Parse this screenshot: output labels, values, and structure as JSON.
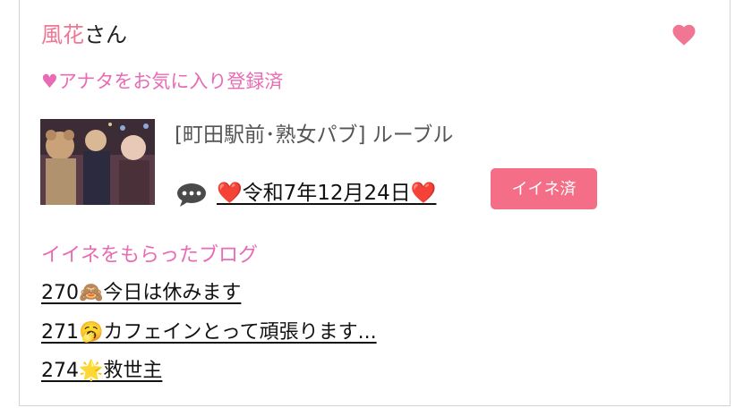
{
  "profile": {
    "name": "風花",
    "suffix": "さん"
  },
  "favorite_status": "♥アナタをお気に入り登録済",
  "shop": {
    "name": "[町田駅前･熟女パブ]  ルーブル"
  },
  "post": {
    "date": "❤️令和7年12月24日❤️",
    "like_label": "イイネ済"
  },
  "blog": {
    "heading": "イイネをもらったブログ",
    "items": [
      {
        "label": "270🙈今日は休みます"
      },
      {
        "label": "271🥱カフェインとって頑張ります..."
      },
      {
        "label": "274🌟救世主"
      }
    ]
  },
  "colors": {
    "accent_pink": "#f07693",
    "heading_pink": "#e96bb4",
    "button_pink": "#f36e86"
  },
  "icons": {
    "favorite": "heart-icon",
    "comment": "speech-bubble-icon"
  }
}
